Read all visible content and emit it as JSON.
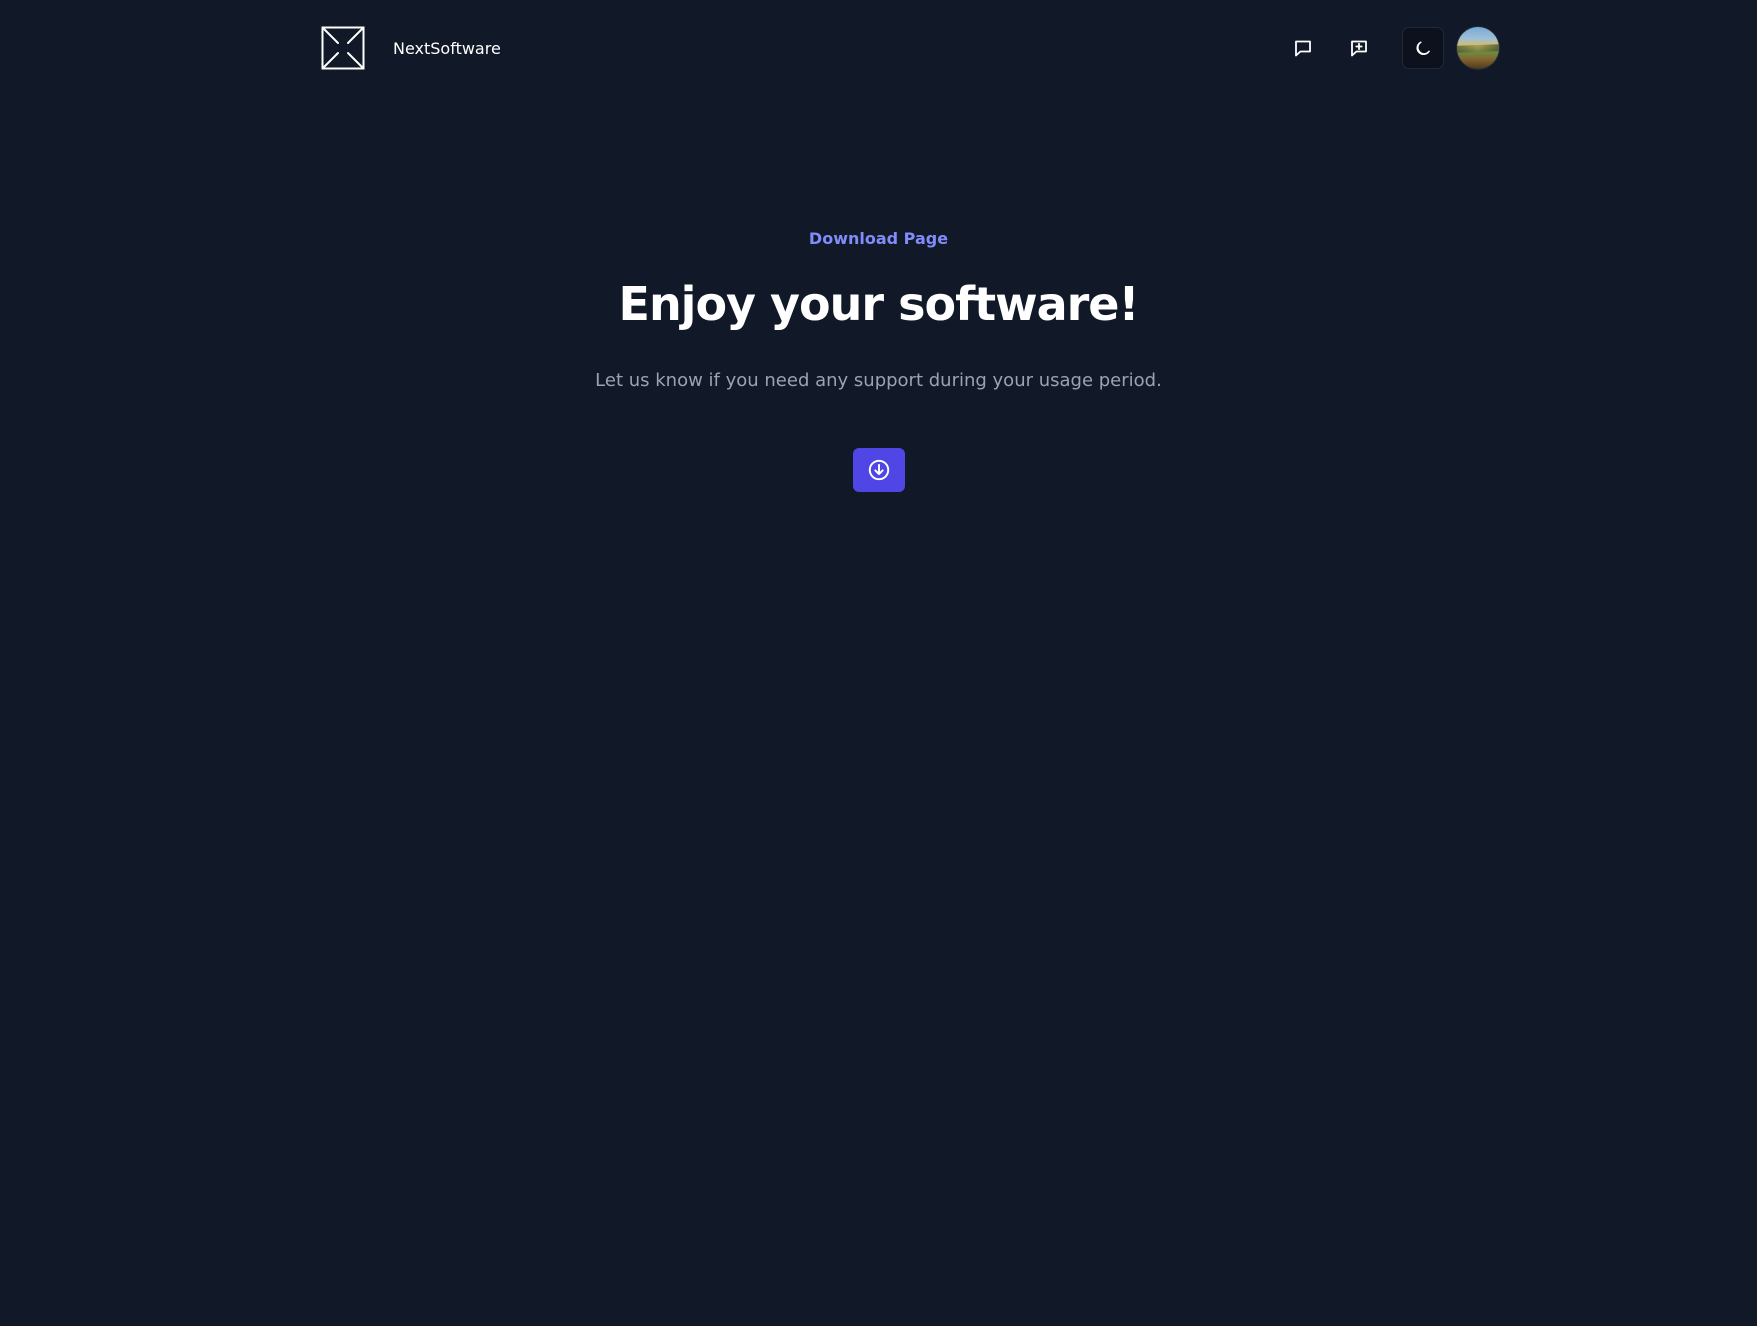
{
  "header": {
    "brand_name": "NextSoftware",
    "icons": {
      "logo": "image-placeholder-icon",
      "chat": "chat-bubble-icon",
      "add_chat": "chat-plus-icon",
      "theme": "moon-icon",
      "avatar": "landscape-avatar"
    }
  },
  "hero": {
    "eyebrow": "Download Page",
    "title": "Enjoy your software!",
    "subtitle": "Let us know if you need any support during your usage period.",
    "download_icon": "arrow-down-circle-icon"
  },
  "colors": {
    "background": "#111827",
    "accent": "#4f46e5",
    "eyebrow": "#818cf8",
    "muted_text": "#9ca3af",
    "text": "#ffffff"
  }
}
